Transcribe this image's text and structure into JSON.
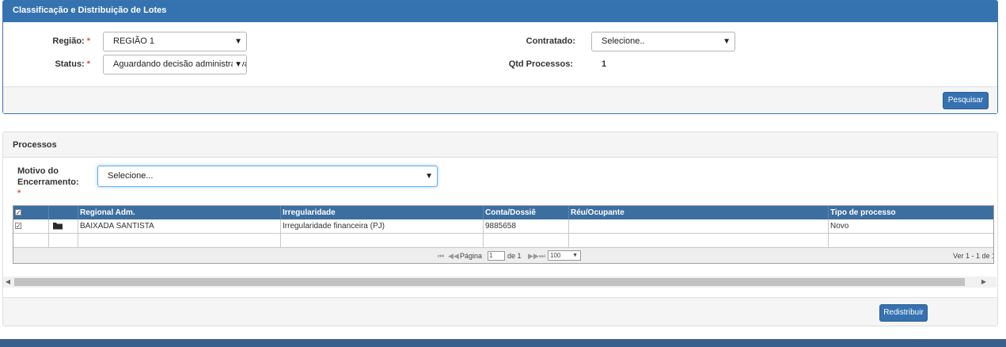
{
  "header": {
    "title": "Classificação e Distribuição de Lotes"
  },
  "filters": {
    "regiao_label": "Região:",
    "regiao_value": "REGIÃO 1",
    "status_label": "Status:",
    "status_value": "Aguardando decisão administrativa",
    "required_mark": "*",
    "contratado_label": "Contratado:",
    "contratado_value": "Selecione..",
    "qtd_label": "Qtd Processos:",
    "qtd_value": "1",
    "search_button": "Pesquisar"
  },
  "processos": {
    "title": "Processos",
    "motivo_label": "Motivo do Encerramento:",
    "motivo_value": "Selecione...",
    "columns": [
      "Regional Adm.",
      "Irregularidade",
      "Conta/Dossiê",
      "Réu/Ocupante",
      "Tipo de processo"
    ],
    "rows": [
      {
        "checked": true,
        "regional": "BAIXADA SANTISTA",
        "irregularidade": "Irregularidade financeira (PJ)",
        "conta": "9885658",
        "reu": "",
        "tipo": "Novo"
      }
    ],
    "pager": {
      "page_label": "Página",
      "page_value": "1",
      "of_label": "de 1",
      "page_size": "100",
      "records": "Ver 1 - 1 de 1"
    },
    "redistribute_button": "Redistribuir"
  },
  "colors": {
    "header_blue": "#3573b0",
    "grid_header": "#3d6ea0",
    "button_blue": "#3671b0",
    "required": "#d9534f"
  },
  "icons": [
    "dropdown-arrow-icon",
    "folder-icon",
    "first-page-icon",
    "prev-page-icon",
    "next-page-icon",
    "last-page-icon",
    "scroll-left-icon",
    "scroll-right-icon"
  ]
}
